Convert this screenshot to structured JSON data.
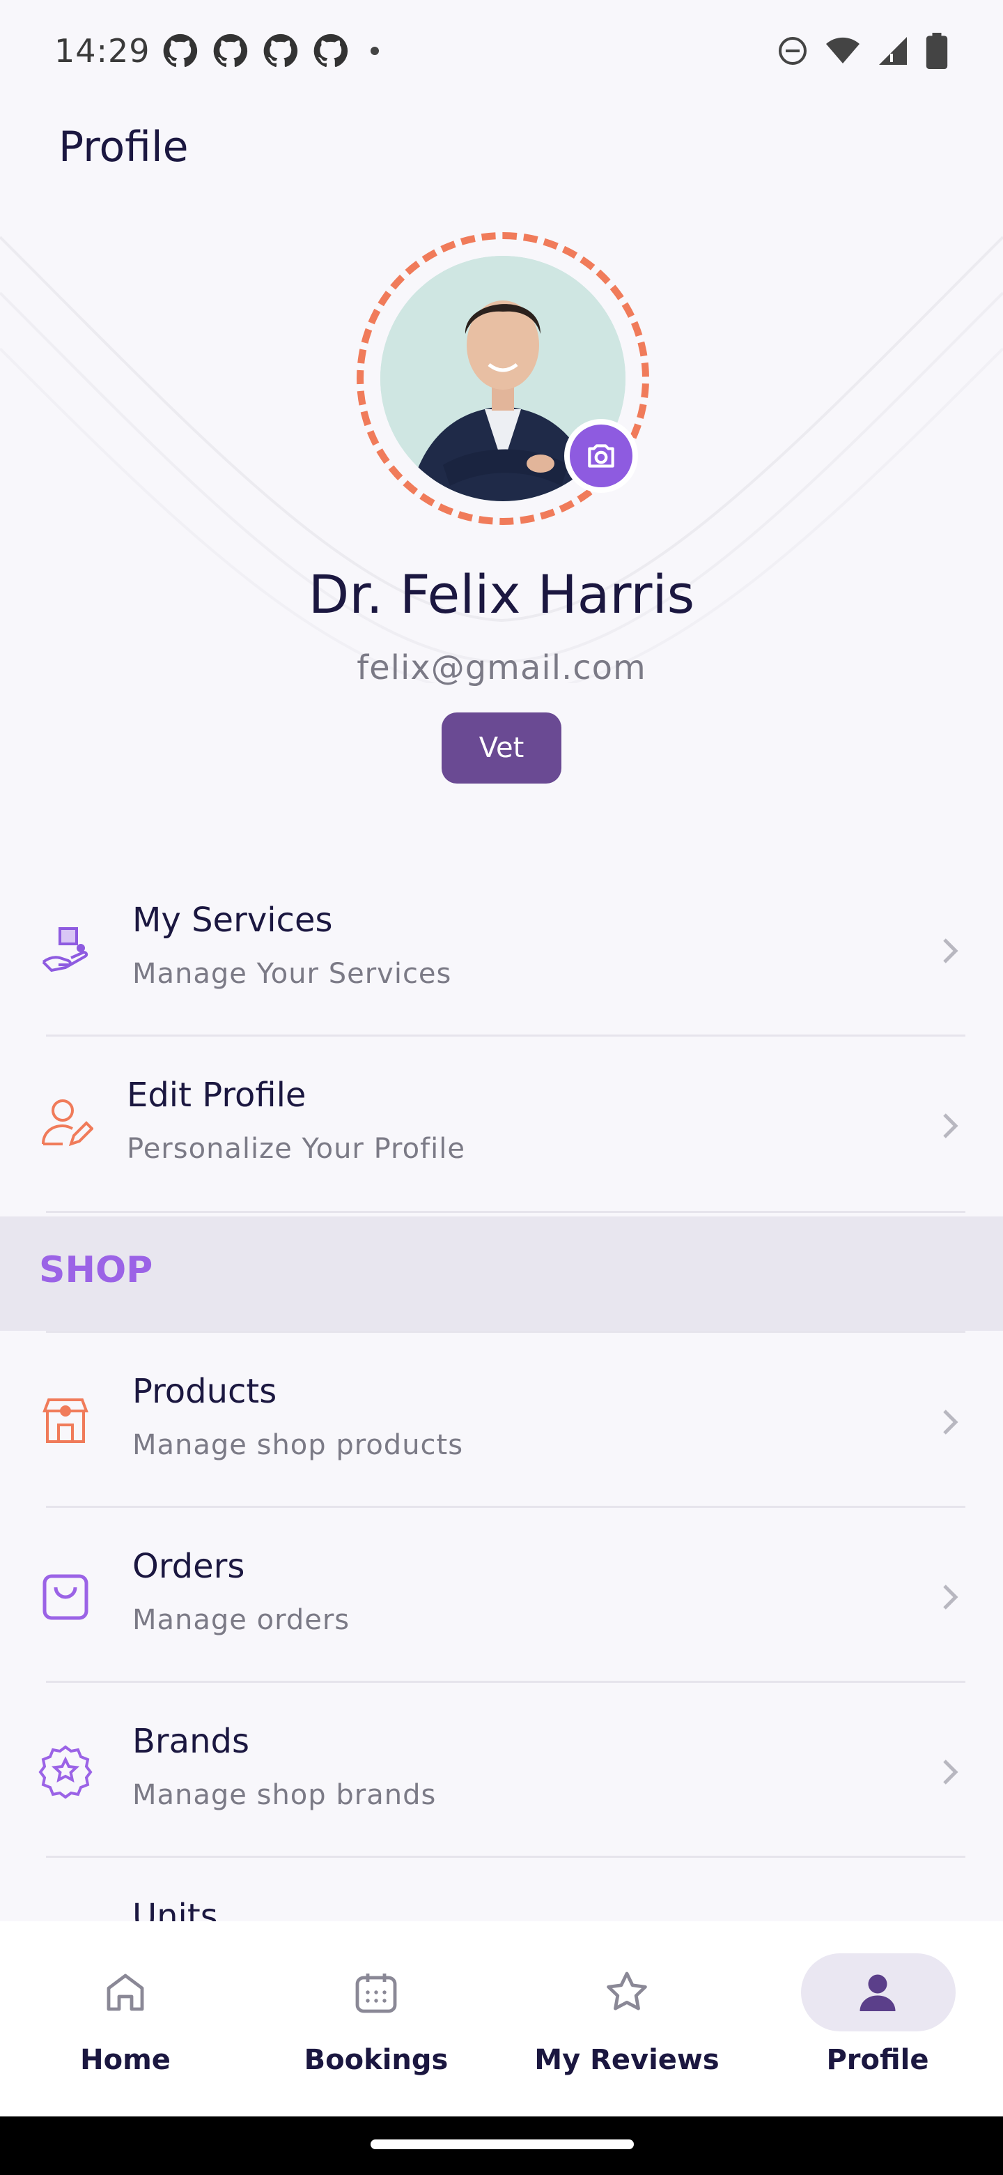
{
  "status_bar": {
    "time": "14:29"
  },
  "header": {
    "title": "Profile"
  },
  "profile": {
    "name": "Dr. Felix Harris",
    "email": "felix@gmail.com",
    "role": "Vet"
  },
  "menu": [
    {
      "title": "My Services",
      "subtitle": "Manage Your Services",
      "icon": "services-hand-icon"
    },
    {
      "title": "Edit Profile",
      "subtitle": "Personalize Your Profile",
      "icon": "edit-profile-icon"
    }
  ],
  "shop_section": {
    "label": "SHOP"
  },
  "shop_menu": [
    {
      "title": "Products",
      "subtitle": "Manage shop products",
      "icon": "shop-store-icon"
    },
    {
      "title": "Orders",
      "subtitle": "Manage orders",
      "icon": "shopping-bag-icon"
    },
    {
      "title": "Brands",
      "subtitle": "Manage shop brands",
      "icon": "badge-star-icon"
    },
    {
      "title": "Units",
      "subtitle": "",
      "icon": "units-icon"
    }
  ],
  "bottom_nav": [
    {
      "label": "Home",
      "icon": "home-icon",
      "active": false
    },
    {
      "label": "Bookings",
      "icon": "calendar-icon",
      "active": false
    },
    {
      "label": "My Reviews",
      "icon": "star-icon",
      "active": false
    },
    {
      "label": "Profile",
      "icon": "person-icon",
      "active": true
    }
  ],
  "colors": {
    "accent": "#8E5BE0",
    "ring": "#F07B5A",
    "role_badge": "#6A4A93",
    "text_primary": "#1B1740",
    "text_secondary": "#7B7A86",
    "section_band": "#E8E6EF"
  }
}
